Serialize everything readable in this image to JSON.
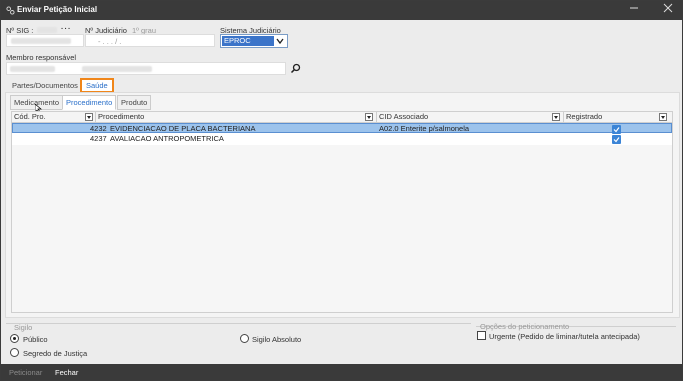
{
  "window": {
    "title": "Enviar Petição Inicial"
  },
  "form": {
    "sig_label": "Nº SIG :",
    "judicial_label": "Nº Judiciário",
    "grau_label": "1º grau",
    "judicial_value": "-  .  .  .  /  .",
    "sistema_label": "Sistema Judiciário",
    "sistema_value": "EPROC",
    "membro_label": "Membro responsável"
  },
  "outer_tabs": [
    {
      "label": "Partes/Documentos"
    },
    {
      "label": "Saúde"
    }
  ],
  "inner_tabs": [
    {
      "label": "Medicamento"
    },
    {
      "label": "Procedimento"
    },
    {
      "label": "Produto"
    }
  ],
  "grid": {
    "columns": [
      "Cód. Pro.",
      "Procedimento",
      "CID Associado",
      "Registrado"
    ],
    "rows": [
      {
        "codigo": "4232",
        "procedimento": "EVIDENCIACAO DE PLACA BACTERIANA",
        "cid": "A02.0 Enterite p/salmonela",
        "registrado": true
      },
      {
        "codigo": "4237",
        "procedimento": "AVALIACAO ANTROPOMETRICA",
        "cid": "",
        "registrado": true
      }
    ]
  },
  "sigilo": {
    "label": "Sigilo",
    "options": [
      {
        "label": "Público",
        "selected": true
      },
      {
        "label": "Segredo de Justiça",
        "selected": false
      },
      {
        "label": "Sigilo Absoluto",
        "selected": false
      }
    ]
  },
  "opcoes": {
    "label": "Opções do peticionamento",
    "urgente_label": "Urgente (Pedido de liminar/tutela antecipada)",
    "urgente_checked": false
  },
  "footer": {
    "peticionar": "Peticionar",
    "fechar": "Fechar"
  },
  "colors": {
    "titlebar": "#3a3a3a",
    "accent": "#2a6fc9",
    "highlight": "#f0861a",
    "selection": "#9cc3ec"
  }
}
